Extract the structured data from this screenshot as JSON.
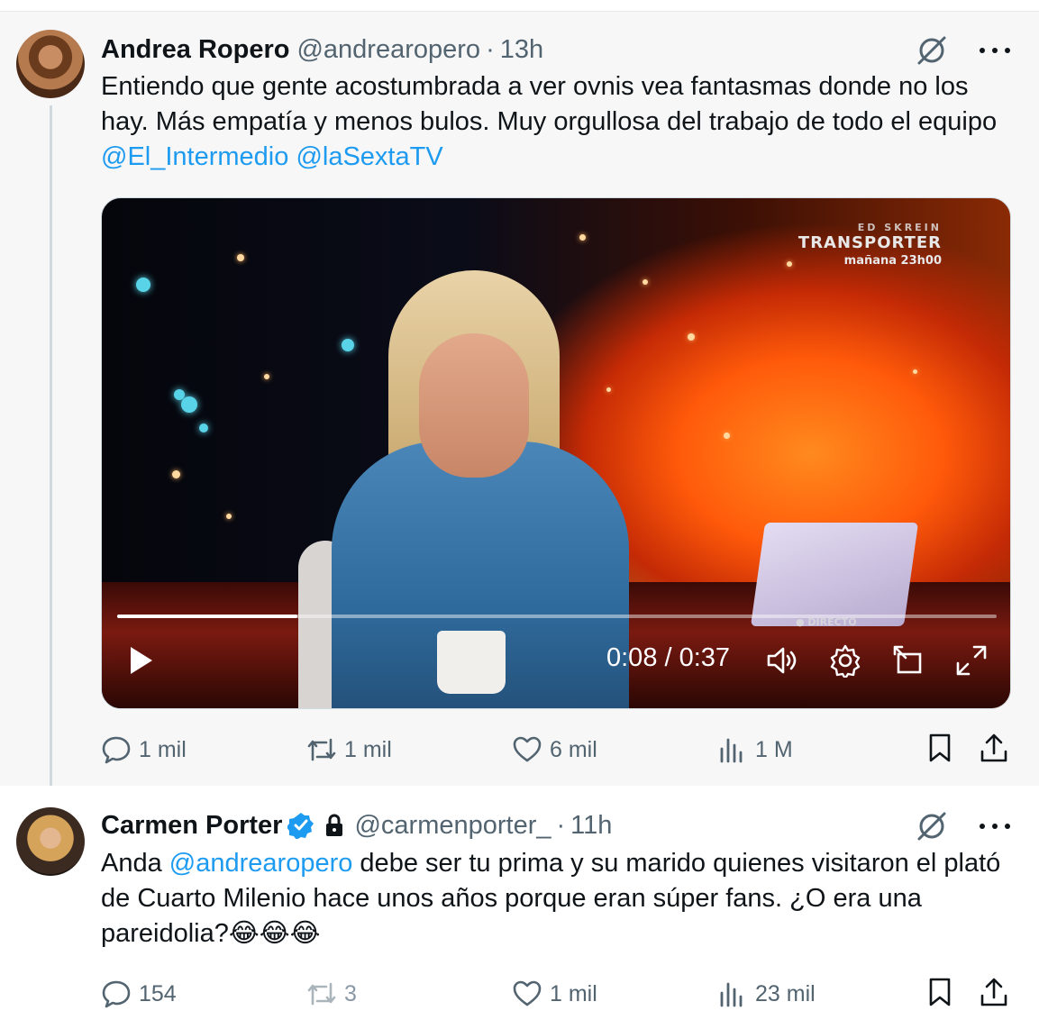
{
  "tweets": [
    {
      "name": "Andrea Ropero",
      "handle": "@andrearopero",
      "separator": "·",
      "time": "13h",
      "text_parts": {
        "before": "Entiendo que gente acostumbrada a ver ovnis vea fantasmas donde no los hay. Más empatía y menos bulos. Muy orgullosa del trabajo de todo el equipo ",
        "mention1": "@El_Intermedio",
        "space": " ",
        "mention2": "@laSextaTV"
      },
      "video": {
        "tv_overlay_line1": "ED SKREIN",
        "tv_overlay_line2": "TRANSPORTER",
        "tv_overlay_line3": "mañana 23h00",
        "tv_live_tag": "● DIRECTO",
        "time_display": "0:08 / 0:37",
        "progress_fraction": 0.205
      },
      "actions": {
        "replies": "1 mil",
        "reposts": "1 mil",
        "likes": "6 mil",
        "views": "1 M"
      }
    },
    {
      "name": "Carmen Porter",
      "handle": "@carmenporter_",
      "separator": "·",
      "time": "11h",
      "text_parts": {
        "before": "Anda ",
        "mention1": "@andrearopero",
        "after": " debe ser tu prima y su marido quienes visitaron el plató de Cuarto Milenio hace unos años porque eran súper fans. ¿O era una pareidolia?😂😂😂"
      },
      "actions": {
        "replies": "154",
        "reposts": "3",
        "likes": "1 mil",
        "views": "23 mil"
      }
    }
  ],
  "colors": {
    "link": "#1d9bf0",
    "secondary_text": "#536471",
    "verified_badge": "#1d9bf0",
    "thread_background": "#f7f7f7"
  },
  "icons": [
    "grok-icon",
    "more-icon",
    "verified-badge-icon",
    "lock-icon",
    "play-icon",
    "volume-icon",
    "settings-icon",
    "pip-icon",
    "fullscreen-icon",
    "reply-icon",
    "repost-icon",
    "like-icon",
    "views-icon",
    "bookmark-icon",
    "share-icon"
  ]
}
